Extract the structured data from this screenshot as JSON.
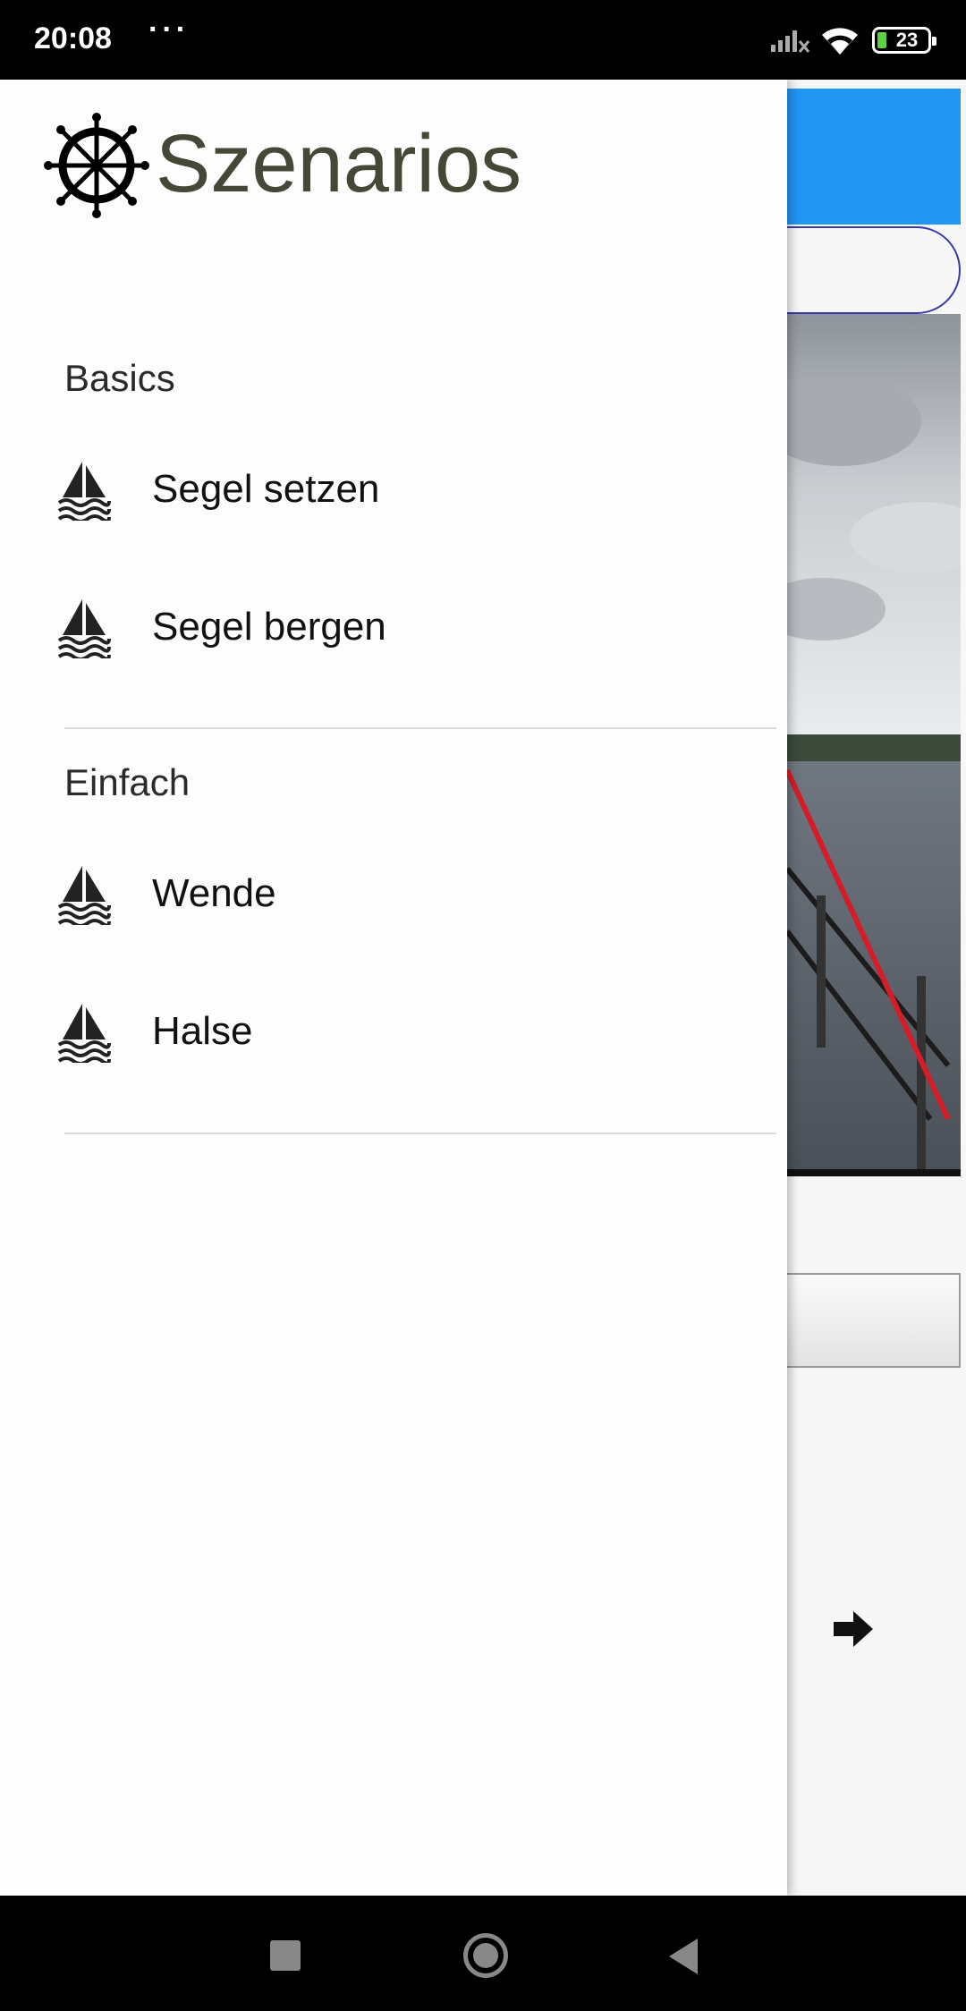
{
  "status_bar": {
    "time": "20:08",
    "overflow": "···",
    "battery_level": "23",
    "icons": [
      "signal-icon",
      "wifi-icon",
      "battery-icon"
    ]
  },
  "drawer": {
    "title": "Szenarios",
    "logo_icon": "ship-wheel-icon",
    "sections": [
      {
        "label": "Basics",
        "items": [
          {
            "label": "Segel setzen",
            "icon": "sailboat-icon"
          },
          {
            "label": "Segel bergen",
            "icon": "sailboat-icon"
          }
        ]
      },
      {
        "label": "Einfach",
        "items": [
          {
            "label": "Wende",
            "icon": "sailboat-icon"
          },
          {
            "label": "Halse",
            "icon": "sailboat-icon"
          }
        ]
      }
    ]
  },
  "background_app": {
    "accent_color": "#2196f3",
    "next_icon": "arrow-right-icon"
  },
  "nav_bar": {
    "buttons": [
      "recent-apps-icon",
      "home-icon",
      "back-icon"
    ]
  }
}
